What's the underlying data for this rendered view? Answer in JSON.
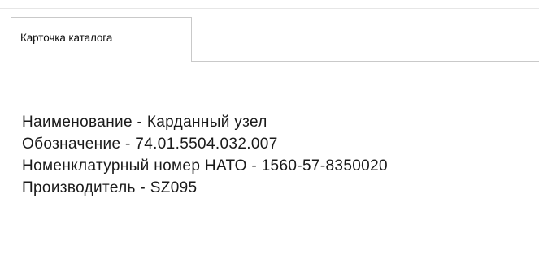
{
  "tab": {
    "label": "Карточка каталога"
  },
  "card": {
    "fields": [
      "Наименование - Карданный узел",
      "Обозначение - 74.01.5504.032.007",
      "Номенклатурный номер НАТО - 1560-57-8350020",
      "Производитель - SZ095"
    ]
  }
}
